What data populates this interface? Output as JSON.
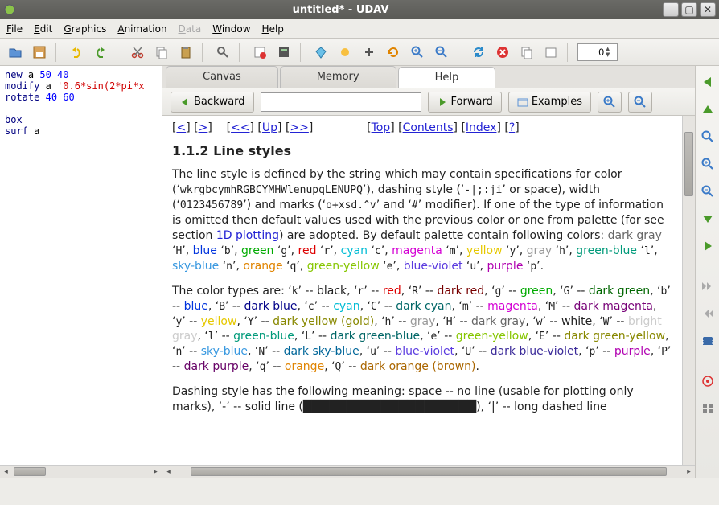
{
  "window": {
    "title": "untitled* - UDAV"
  },
  "menu": {
    "file": "File",
    "edit": "Edit",
    "graphics": "Graphics",
    "animation": "Animation",
    "data": "Data",
    "window": "Window",
    "help": "Help"
  },
  "toolbar": {
    "spin_value": "0"
  },
  "code": {
    "lines": [
      {
        "kw": "new",
        "rest": " a ",
        "nums": "50 40"
      },
      {
        "kw": "modify",
        "rest": " a ",
        "str": "'0.6*sin(2*pi*x"
      },
      {
        "kw": "rotate",
        "rest": " ",
        "nums": "40 60"
      },
      {
        "kw": "",
        "rest": "",
        "nums": ""
      },
      {
        "kw": "box",
        "rest": "",
        "nums": ""
      },
      {
        "kw": "surf",
        "rest": " a",
        "nums": ""
      }
    ]
  },
  "tabs": {
    "canvas": "Canvas",
    "memory": "Memory",
    "help": "Help"
  },
  "help_toolbar": {
    "backward": "Backward",
    "forward": "Forward",
    "examples": "Examples",
    "search_value": ""
  },
  "nav": {
    "lt": "<",
    "gt": ">",
    "ltlt": "<<",
    "up": "Up",
    "gtgt": ">>",
    "top": "Top",
    "contents": "Contents",
    "index": "Index",
    "q": "?"
  },
  "doc": {
    "heading": "1.1.2 Line styles",
    "p1a": "The line style is defined by the string which may contain specifications for color (‘",
    "p1_colorset": "wkrgbcymhRGBCYMHWlenupqLENUPQ",
    "p1b": "’), dashing style (‘",
    "p1_dash": "-|;:ji",
    "p1c": "’ or space), width (‘",
    "p1_width": "0123456789",
    "p1d": "’) and marks (‘",
    "p1_marks": "o+xsd.^v",
    "p1e": "’ and ‘",
    "p1_hash": "#",
    "p1f": "’ modifier). If one of the type of information is omitted then default values used with the previous color or one from palette (for see section ",
    "p1_link": "1D plotting",
    "p1g": ") are adopted. By default palette contain following colors: ",
    "pal": [
      {
        "txt": "dark gray",
        "cls": "c-darkgray",
        "code": "H"
      },
      {
        "txt": "blue",
        "cls": "c-blue",
        "code": "b"
      },
      {
        "txt": "green",
        "cls": "c-green",
        "code": "g"
      },
      {
        "txt": "red",
        "cls": "c-red",
        "code": "r"
      },
      {
        "txt": "cyan",
        "cls": "c-cyan",
        "code": "c"
      },
      {
        "txt": "magenta",
        "cls": "c-magenta",
        "code": "m"
      },
      {
        "txt": "yellow",
        "cls": "c-yellow",
        "code": "y"
      },
      {
        "txt": "gray",
        "cls": "c-gray",
        "code": "h"
      },
      {
        "txt": "green-blue",
        "cls": "c-greenblue",
        "code": "l"
      },
      {
        "txt": "sky-blue",
        "cls": "c-skyblue",
        "code": "n"
      },
      {
        "txt": "orange",
        "cls": "c-orange",
        "code": "q"
      },
      {
        "txt": "green-yellow",
        "cls": "c-greenyellow",
        "code": "e"
      },
      {
        "txt": "blue-violet",
        "cls": "c-blueviolet",
        "code": "u"
      },
      {
        "txt": "purple",
        "cls": "c-purple",
        "code": "p"
      }
    ],
    "p2a": "The color types are: ‘",
    "colortypes": [
      {
        "code": "k",
        "txt": "black",
        "cls": ""
      },
      {
        "code": "r",
        "txt": "red",
        "cls": "c-red"
      },
      {
        "code": "R",
        "txt": "dark red",
        "cls": "c-darkred"
      },
      {
        "code": "g",
        "txt": "green",
        "cls": "c-green"
      },
      {
        "code": "G",
        "txt": "dark green",
        "cls": "c-darkgreen"
      },
      {
        "code": "b",
        "txt": "blue",
        "cls": "c-blue"
      },
      {
        "code": "B",
        "txt": "dark blue",
        "cls": "c-darkblue"
      },
      {
        "code": "c",
        "txt": "cyan",
        "cls": "c-cyan"
      },
      {
        "code": "C",
        "txt": "dark cyan",
        "cls": "c-darkcyan"
      },
      {
        "code": "m",
        "txt": "magenta",
        "cls": "c-magenta"
      },
      {
        "code": "M",
        "txt": "dark magenta",
        "cls": "c-darkmagenta"
      },
      {
        "code": "y",
        "txt": "yellow",
        "cls": "c-yellow"
      },
      {
        "code": "Y",
        "txt": "dark yellow (gold)",
        "cls": "c-darkyellow"
      },
      {
        "code": "h",
        "txt": "gray",
        "cls": "c-gray"
      },
      {
        "code": "H",
        "txt": "dark gray",
        "cls": "c-darkgray"
      },
      {
        "code": "w",
        "txt": "white",
        "cls": ""
      },
      {
        "code": "W",
        "txt": "bright gray",
        "cls": "c-brightgray"
      },
      {
        "code": "l",
        "txt": "green-blue",
        "cls": "c-greenblue"
      },
      {
        "code": "L",
        "txt": "dark green-blue",
        "cls": "c-darkcyan"
      },
      {
        "code": "e",
        "txt": "green-yellow",
        "cls": "c-greenyellow"
      },
      {
        "code": "E",
        "txt": "dark green-yellow",
        "cls": "c-darkyellow"
      },
      {
        "code": "n",
        "txt": "sky-blue",
        "cls": "c-skyblue"
      },
      {
        "code": "N",
        "txt": "dark sky-blue",
        "cls": "c-darkskyblue"
      },
      {
        "code": "u",
        "txt": "blue-violet",
        "cls": "c-blueviolet"
      },
      {
        "code": "U",
        "txt": "dark blue-violet",
        "cls": "c-darkblueviolet"
      },
      {
        "code": "p",
        "txt": "purple",
        "cls": "c-purple"
      },
      {
        "code": "P",
        "txt": "dark purple",
        "cls": "c-darkpurple"
      },
      {
        "code": "q",
        "txt": "orange",
        "cls": "c-orange"
      },
      {
        "code": "Q",
        "txt": "dark orange (brown)",
        "cls": "c-darkorange"
      }
    ],
    "p3": "Dashing style has the following meaning: space -- no line (usable for plotting only marks), ‘-’ -- solid line (████████████████████), ‘|’ -- long dashed line"
  }
}
